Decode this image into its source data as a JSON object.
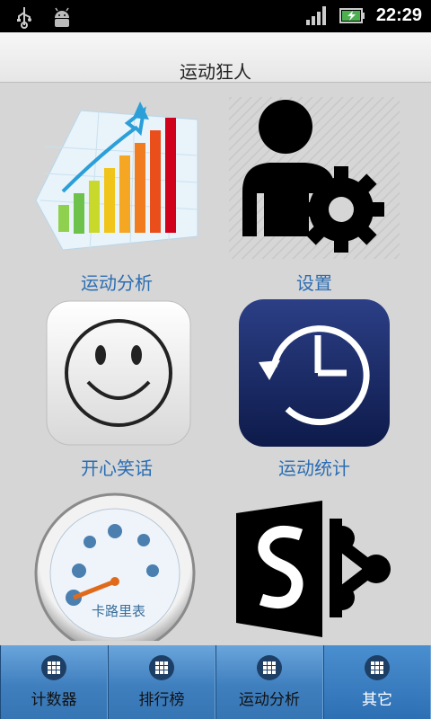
{
  "status_bar": {
    "time": "22:29",
    "icons": [
      "usb-icon",
      "android-debug-icon",
      "signal-icon",
      "battery-charging-icon"
    ]
  },
  "header": {
    "title": "运动狂人"
  },
  "grid": {
    "items": [
      {
        "label": "运动分析",
        "icon": "growth-chart-icon"
      },
      {
        "label": "设置",
        "icon": "user-settings-icon"
      },
      {
        "label": "开心笑话",
        "icon": "smiley-face-icon"
      },
      {
        "label": "运动统计",
        "icon": "clock-history-icon"
      },
      {
        "label": "",
        "icon": "calorie-gauge-icon",
        "gauge_text": "卡路里表"
      },
      {
        "label": "",
        "icon": "sharepoint-logo-icon"
      }
    ]
  },
  "tabs": [
    {
      "label": "计数器",
      "icon": "grid-icon",
      "active": false
    },
    {
      "label": "排行榜",
      "icon": "grid-icon",
      "active": false
    },
    {
      "label": "运动分析",
      "icon": "grid-icon",
      "active": false
    },
    {
      "label": "其它",
      "icon": "grid-icon",
      "active": true
    }
  ],
  "colors": {
    "label_blue": "#2b6db3",
    "tab_blue": "#3f7fbe"
  }
}
